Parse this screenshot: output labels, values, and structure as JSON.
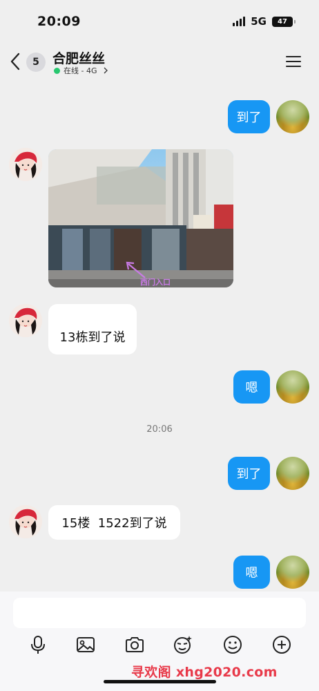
{
  "status_bar": {
    "time": "20:09",
    "network": "5G",
    "battery": "47"
  },
  "header": {
    "unread_count": "5",
    "contact_name": "合肥丝丝",
    "contact_status": "在线 - 4G"
  },
  "messages": {
    "m1": "到了",
    "m2_image_caption": "西门入口",
    "m3": "13栋到了说",
    "m4": "嗯",
    "divider_time": "20:06",
    "m5": "到了",
    "m6": "15楼  1522到了说",
    "m7": "嗯"
  },
  "input": {
    "placeholder": ""
  },
  "toolbar": {
    "icons": [
      "microphone-icon",
      "image-icon",
      "camera-icon",
      "sticker-icon",
      "emoji-icon",
      "plus-icon"
    ]
  },
  "watermark": "寻欢阁 xhg2020.com",
  "colors": {
    "accent": "#1797f4",
    "online": "#28c76f",
    "watermark": "#e83a4a"
  }
}
